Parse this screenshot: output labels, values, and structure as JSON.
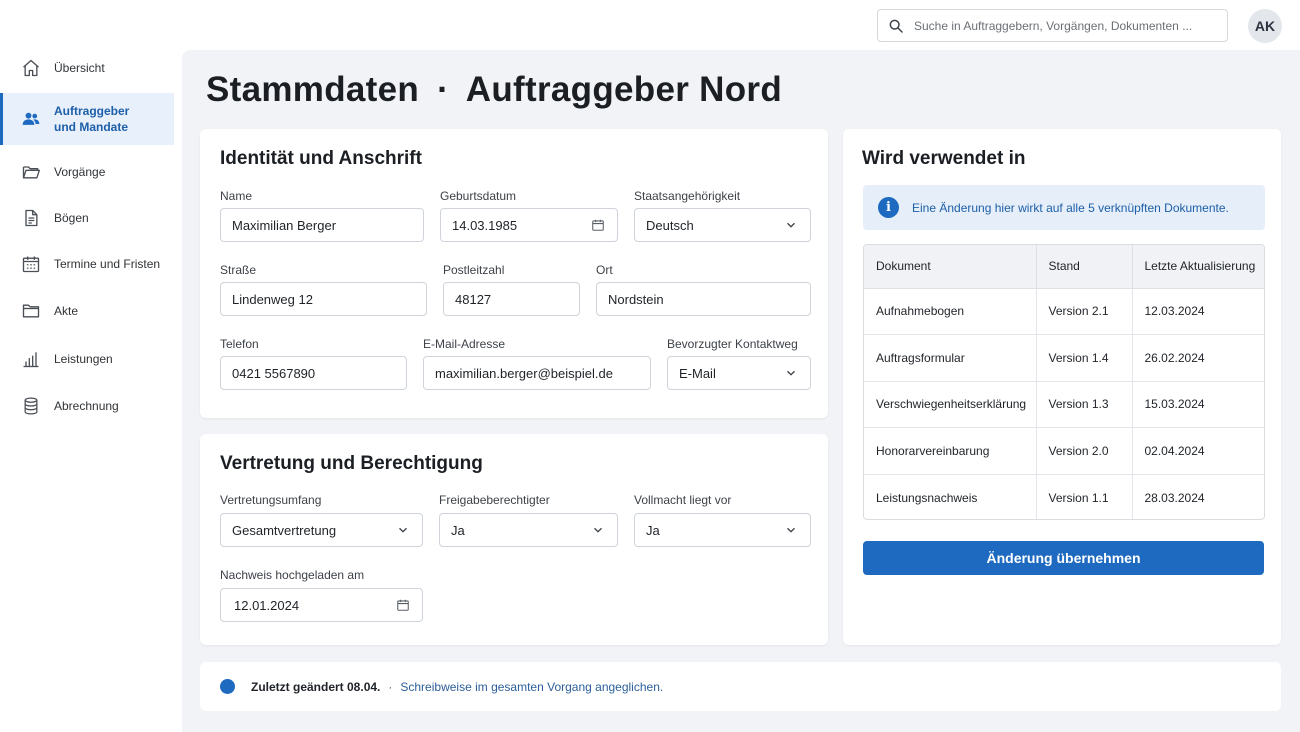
{
  "search": {
    "placeholder": "Suche in Auftraggebern, Vorgängen, Dokumenten ..."
  },
  "user": {
    "initials": "AK"
  },
  "sidebar": {
    "items": [
      {
        "label": "Übersicht",
        "icon": "home-icon"
      },
      {
        "label_line1": "Auftraggeber",
        "label_line2": "und Mandate",
        "icon": "users-icon",
        "active": true
      },
      {
        "label": "Vorgänge",
        "icon": "folder-open-icon"
      },
      {
        "label": "Bögen",
        "icon": "document-icon"
      },
      {
        "label": "Termine und Fristen",
        "icon": "calendar-icon"
      },
      {
        "label": "Akte",
        "icon": "folder-icon"
      },
      {
        "label": "Leistungen",
        "icon": "bar-chart-icon"
      },
      {
        "label": "Abrechnung",
        "icon": "coins-icon"
      }
    ]
  },
  "page": {
    "title": "Stammdaten",
    "separator": "·",
    "subtitle": "Auftraggeber Nord"
  },
  "identity": {
    "title": "Identität und Anschrift",
    "name_label": "Name",
    "name_value": "Maximilian Berger",
    "birth_label": "Geburtsdatum",
    "birth_value": "14.03.1985",
    "nationality_label": "Staatsangehörigkeit",
    "nationality_value": "Deutsch",
    "street_label": "Straße",
    "street_value": "Lindenweg 12",
    "zip_label": "Postleitzahl",
    "zip_value": "48127",
    "city_label": "Ort",
    "city_value": "Nordstein",
    "phone_label": "Telefon",
    "phone_value": "0421 5567890",
    "email_label": "E-Mail-Adresse",
    "email_value": "maximilian.berger@beispiel.de",
    "contact_label": "Bevorzugter Kontaktweg",
    "contact_value": "E-Mail"
  },
  "representation": {
    "title": "Vertretung und Berechtigung",
    "scope_label": "Vertretungsumfang",
    "scope_value": "Gesamtvertretung",
    "approver_label": "Freigabeberechtigter",
    "approver_value": "Ja",
    "poa_label": "Vollmacht liegt vor",
    "poa_value": "Ja",
    "proof_label": "Nachweis hochgeladen am",
    "proof_value": "12.01.2024"
  },
  "usage": {
    "title": "Wird verwendet in",
    "info_text": "Eine Änderung hier wirkt auf alle 5 verknüpften Dokumente.",
    "columns": [
      "Dokument",
      "Stand",
      "Letzte Aktualisierung"
    ],
    "rows": [
      [
        "Aufnahmebogen",
        "Version 2.1",
        "12.03.2024"
      ],
      [
        "Auftragsformular",
        "Version 1.4",
        "26.02.2024"
      ],
      [
        "Verschwiegenheitserklärung",
        "Version 1.3",
        "15.03.2024"
      ],
      [
        "Honorarvereinbarung",
        "Version 2.0",
        "02.04.2024"
      ],
      [
        "Leistungsnachweis",
        "Version 1.1",
        "28.03.2024"
      ]
    ],
    "apply_label": "Änderung übernehmen"
  },
  "status": {
    "changed": "Zuletzt geändert 08.04.",
    "separator": "·",
    "message": "Schreibweise im gesamten Vorgang angeglichen."
  },
  "colors": {
    "accent": "#1d6ac0",
    "background": "#f1f3f6",
    "info_bg": "#e5eef9"
  }
}
